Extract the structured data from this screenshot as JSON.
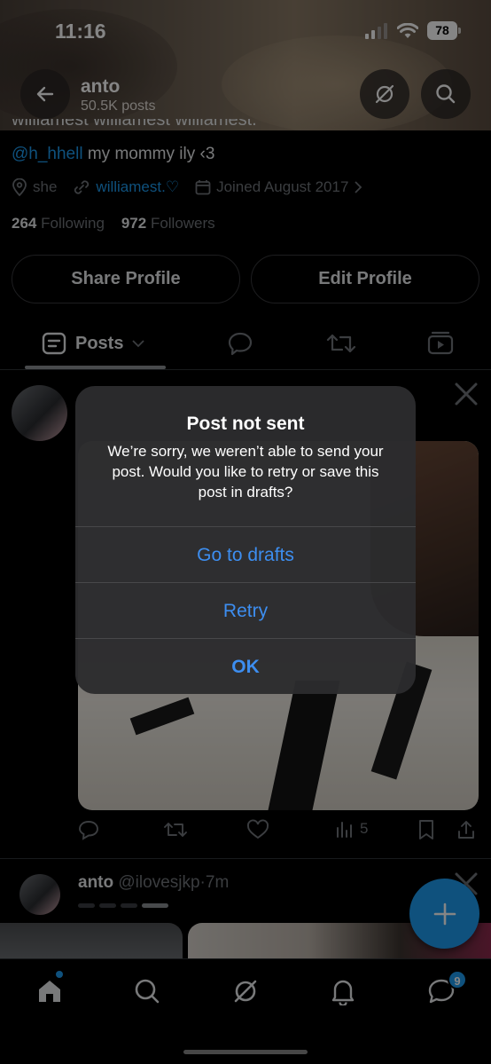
{
  "status_bar": {
    "time": "11:16",
    "battery": "78"
  },
  "header": {
    "name": "anto",
    "posts_count": "50.5K posts"
  },
  "profile": {
    "bio_cut": "williamest williamest williamest.",
    "bio_mention": "@h_hhell",
    "bio_text": " my mommy ily ‹3",
    "pronoun": "she",
    "website": "williamest.♡",
    "joined": "Joined August 2017",
    "following_count": "264",
    "following_label": "Following",
    "followers_count": "972",
    "followers_label": "Followers",
    "share_button": "Share Profile",
    "edit_button": "Edit Profile"
  },
  "tabs": {
    "posts_label": "Posts"
  },
  "post1": {
    "views": "5"
  },
  "post2": {
    "name": "anto",
    "handle": "@ilovesjkp",
    "time": "7m",
    "separator": "·"
  },
  "nav": {
    "messages_badge": "9"
  },
  "alert": {
    "title": "Post not sent",
    "message": "We’re sorry, we weren’t able to send your post. Would you like to retry or save this post in drafts?",
    "buttons": [
      "Go to drafts",
      "Retry",
      "OK"
    ]
  },
  "colors": {
    "accent": "#1d9bf0",
    "alert_button": "#3d8ef0",
    "background": "#000000"
  },
  "icons": [
    "back-arrow-icon",
    "grok-icon",
    "search-icon",
    "location-icon",
    "link-icon",
    "calendar-icon",
    "chevron-right-icon",
    "posts-icon",
    "chevron-down-icon",
    "reply-icon",
    "repost-icon",
    "media-icon",
    "x-logo-icon",
    "like-icon",
    "views-icon",
    "bookmark-icon",
    "share-icon",
    "plus-icon",
    "home-icon",
    "notifications-icon",
    "messages-icon"
  ]
}
